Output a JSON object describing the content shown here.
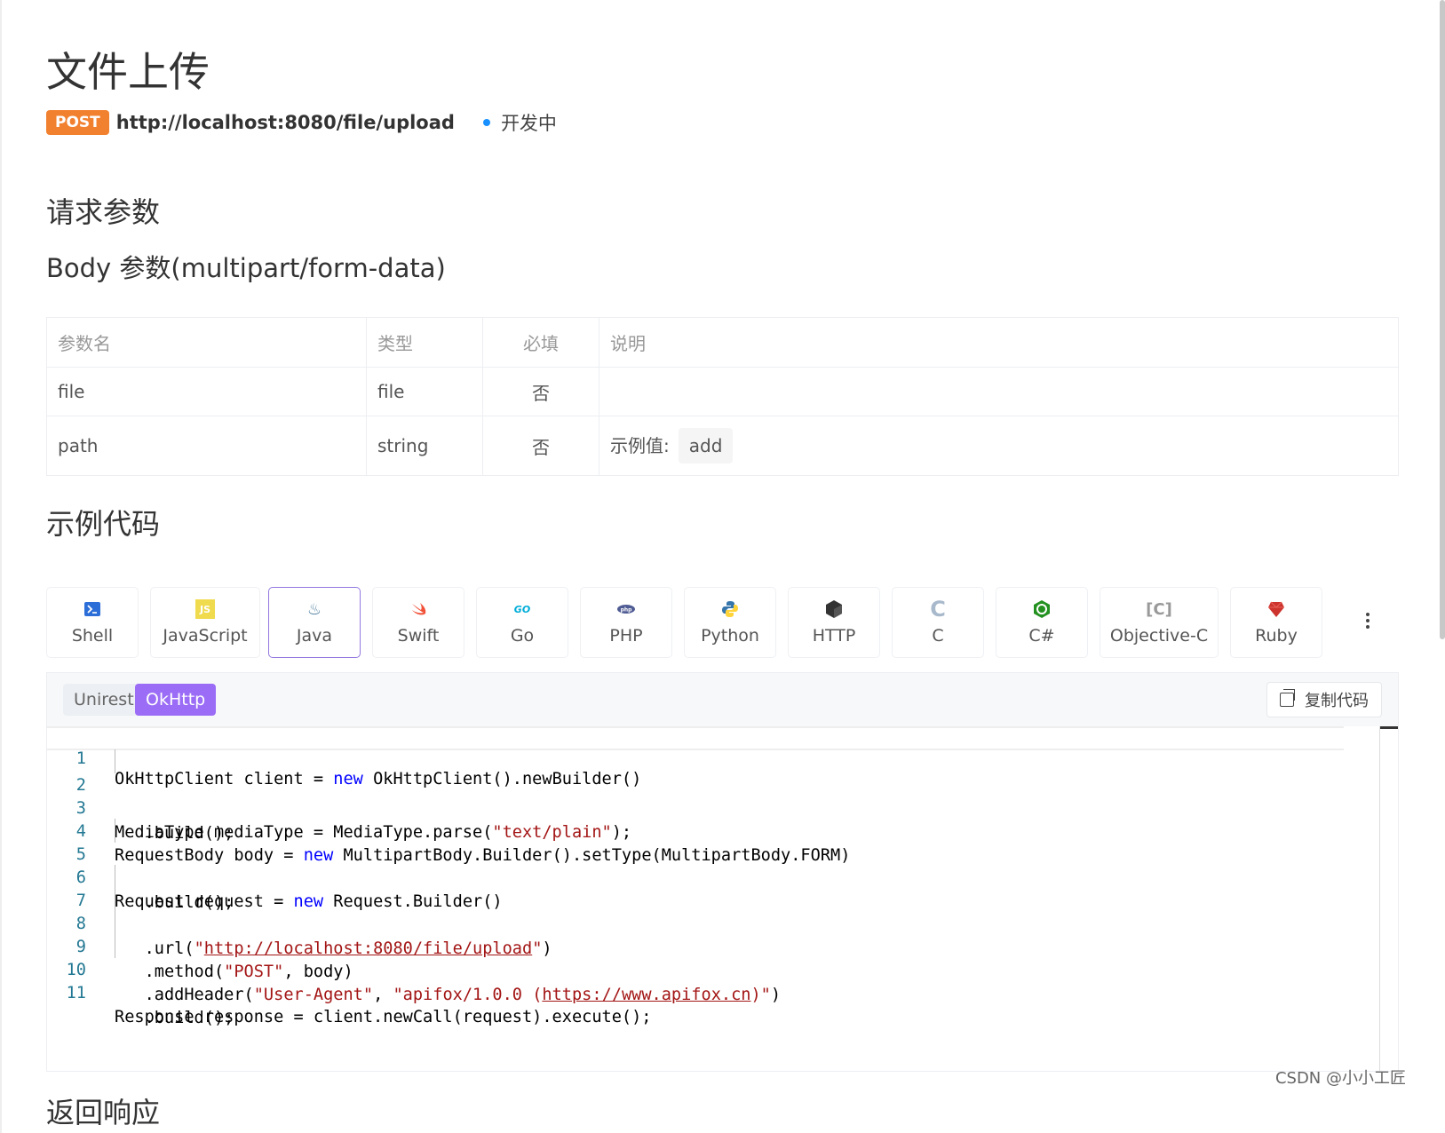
{
  "page": {
    "title": "文件上传",
    "method": "POST",
    "url": "http://localhost:8080/file/upload",
    "status": "开发中"
  },
  "sections": {
    "request_params": "请求参数",
    "body_params": "Body 参数(multipart/form-data)",
    "example_code": "示例代码",
    "response": "返回响应"
  },
  "params_table": {
    "headers": [
      "参数名",
      "类型",
      "必填",
      "说明"
    ],
    "rows": [
      {
        "name": "file",
        "type": "file",
        "required": "否",
        "desc_label": "",
        "example": ""
      },
      {
        "name": "path",
        "type": "string",
        "required": "否",
        "desc_label": "示例值:",
        "example": "add"
      }
    ]
  },
  "languages": [
    {
      "label": "Shell",
      "icon": "shell-icon",
      "active": false
    },
    {
      "label": "JavaScript",
      "icon": "javascript-icon",
      "active": false
    },
    {
      "label": "Java",
      "icon": "java-icon",
      "active": true
    },
    {
      "label": "Swift",
      "icon": "swift-icon",
      "active": false
    },
    {
      "label": "Go",
      "icon": "go-icon",
      "active": false
    },
    {
      "label": "PHP",
      "icon": "php-icon",
      "active": false
    },
    {
      "label": "Python",
      "icon": "python-icon",
      "active": false
    },
    {
      "label": "HTTP",
      "icon": "http-icon",
      "active": false
    },
    {
      "label": "C",
      "icon": "c-icon",
      "active": false
    },
    {
      "label": "C#",
      "icon": "csharp-icon",
      "active": false
    },
    {
      "label": "Objective-C",
      "icon": "objective-c-icon",
      "active": false
    },
    {
      "label": "Ruby",
      "icon": "ruby-icon",
      "active": false
    }
  ],
  "code_panel": {
    "sub_tabs": [
      "Unirest",
      "OkHttp"
    ],
    "active_sub_tab": "OkHttp",
    "copy_label": "复制代码",
    "lines": [
      {
        "n": "1",
        "text": "OkHttpClient client = new OkHttpClient().newBuilder()"
      },
      {
        "n": "2",
        "text": "   .build();"
      },
      {
        "n": "3",
        "text": "MediaType mediaType = MediaType.parse(\"text/plain\");"
      },
      {
        "n": "4",
        "text": "RequestBody body = new MultipartBody.Builder().setType(MultipartBody.FORM)"
      },
      {
        "n": "5",
        "text": "   .build();"
      },
      {
        "n": "6",
        "text": "Request request = new Request.Builder()"
      },
      {
        "n": "7",
        "text": "   .url(\"http://localhost:8080/file/upload\")"
      },
      {
        "n": "8",
        "text": "   .method(\"POST\", body)"
      },
      {
        "n": "9",
        "text": "   .addHeader(\"User-Agent\", \"apifox/1.0.0 (https://www.apifox.cn)\")"
      },
      {
        "n": "10",
        "text": "   .build();"
      },
      {
        "n": "11",
        "text": "Response response = client.newCall(request).execute();"
      }
    ]
  },
  "watermark": "CSDN @小小工匠",
  "colors": {
    "post_badge": "#f2812f",
    "status_dot": "#1890ff",
    "active_tab_border": "#9378e0",
    "okhttp_tab": "#9b6cf6"
  }
}
